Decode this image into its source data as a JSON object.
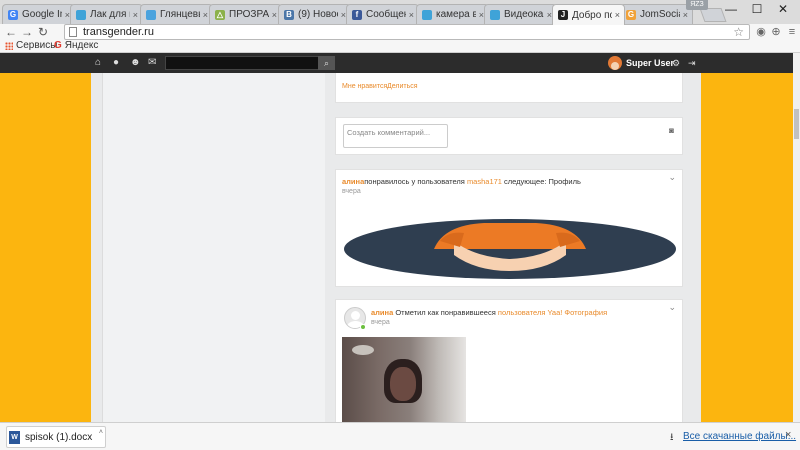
{
  "browser": {
    "tabs": [
      {
        "title": "Google Ima",
        "favicon": "google-icon",
        "color": "#4285f4",
        "glyph": "G"
      },
      {
        "title": "Лак для пл",
        "favicon": "site-icon",
        "color": "#3fa3d8",
        "glyph": ""
      },
      {
        "title": "Глянцевые",
        "favicon": "site-icon",
        "color": "#4ba3de",
        "glyph": ""
      },
      {
        "title": "ПРОЗРАЧН",
        "favicon": "drive-icon",
        "color": "#8bb14a",
        "glyph": "△"
      },
      {
        "title": "(9) Новост",
        "favicon": "vk-icon",
        "color": "#4a76a8",
        "glyph": "В"
      },
      {
        "title": "Сообщени",
        "favicon": "facebook-icon",
        "color": "#3b5998",
        "glyph": "f"
      },
      {
        "title": "камера ви",
        "favicon": "site-icon",
        "color": "#3fa3d8",
        "glyph": ""
      },
      {
        "title": "Видеокам",
        "favicon": "site-icon",
        "color": "#3fa3d8",
        "glyph": ""
      },
      {
        "title": "Добро пож",
        "favicon": "joomla-icon",
        "color": "#222222",
        "glyph": "J",
        "active": true
      },
      {
        "title": "JomSocial",
        "favicon": "jomsocial-icon",
        "color": "#f0a23a",
        "glyph": "G"
      }
    ],
    "tab_close": "×",
    "window_badge": "ЯZЗ",
    "window_controls": {
      "minimize": "—",
      "maximize": "☐",
      "close": "✕"
    },
    "url": "transgender.ru",
    "bookmarks": [
      {
        "label": "Сервисы",
        "icon": "apps-icon"
      },
      {
        "label": "Яндекс",
        "icon": "yandex-icon",
        "glyph": "G"
      }
    ]
  },
  "site": {
    "accent": "#fcb50f",
    "nav_icons": [
      "home-icon",
      "globe-icon",
      "users-icon",
      "mail-icon"
    ],
    "nav_glyphs": [
      "⌂",
      "●",
      "☻",
      "✉"
    ],
    "search_glyph": "🔍",
    "user_name": "Super User",
    "settings_glyph": "⚙",
    "logout_glyph": "⇥"
  },
  "feed": {
    "top_card": {
      "like": "Мне нравится",
      "share": "Делиться"
    },
    "comment_placeholder": "Создать комментарий...",
    "camera_glyph": "📷",
    "activity1": {
      "actor": "алина",
      "text1": "понравилось у пользователя ",
      "target": "masha171",
      "text2": " следующее: Профиль",
      "time": "вчера"
    },
    "activity2": {
      "actor": "алина",
      "text1": " Отметил как понравившееся ",
      "target": "пользователя Yaa! Фотография",
      "time": "вчера"
    },
    "chevron": "⌄"
  },
  "downloads": {
    "file": "spisok (1).docx",
    "file_glyph": "W",
    "arrow": "˄",
    "all": "Все скачанные файлы...",
    "close": "×"
  }
}
